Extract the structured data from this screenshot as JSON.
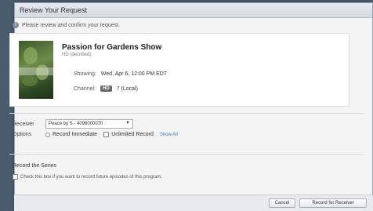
{
  "dialog": {
    "title": "Review Your Request",
    "notice": "Please review and confirm your request."
  },
  "program": {
    "title": "Passion for Gardens Show",
    "subtitle": "HD (decribed)",
    "showing_label": "Showing:",
    "showing_value": "Wed, Apr 6, 12:00 PM EDT",
    "channel_label": "Channel:",
    "channel_badge": "HD",
    "channel_value": "7 (Local)"
  },
  "form": {
    "receiver_label": "Receiver",
    "receiver_value": "Peace by S - 4096000070",
    "options_label": "Options",
    "option_radio": "Record Immediate",
    "option_check": "Unlimited Record",
    "show_more": "Show All"
  },
  "series": {
    "title": "Record the Series",
    "checkbox_label": "Check this box if you want to record future episodes of this program."
  },
  "buttons": {
    "cancel": "Cancel",
    "record": "Record for Receiver"
  }
}
